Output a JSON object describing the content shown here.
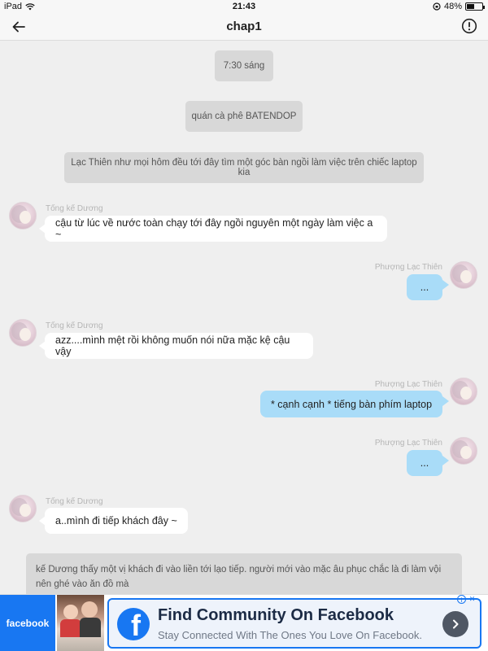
{
  "status_bar": {
    "device": "iPad",
    "time": "21:43",
    "battery": "48%",
    "battery_fraction": 0.48
  },
  "header": {
    "title": "chap1"
  },
  "messages": {
    "time_label": "7:30 sáng",
    "place_label": "quán cà phê BATENDOP",
    "narration_1": "Lạc Thiên như mọi hôm đều tới đây tìm một góc bàn ngồi làm việc trên chiếc laptop kia",
    "sender_a": "Tống kế Dương",
    "sender_b": "Phượng Lạc Thiên",
    "msg_1": "cậu từ lúc về nước toàn chạy tới đây ngồi nguyên một ngày làm việc a ~",
    "msg_2": "...",
    "msg_3": "azz....mình mệt rồi không muốn nói nữa mặc kệ cậu vậy",
    "msg_4": "* cạnh cạnh * tiếng bàn phím laptop",
    "msg_5": "...",
    "msg_6": "a..mình đi tiếp khách đây  ~",
    "narration_2": "kế Dương thấy một vị khách đi vào liền tới lạo tiếp. người mới vào mặc âu phục  chắc là đi làm vội nên ghé vào ăn đồ mà"
  },
  "ad": {
    "brand": "facebook",
    "headline": "Find Community On Facebook",
    "subline": "Stay Connected With The Ones You Love On Facebook.",
    "brand_color": "#1877f2"
  },
  "icons": {
    "back": "arrow-left-icon",
    "info": "info-icon",
    "wifi": "wifi-icon",
    "battery": "battery-icon",
    "ad_next": "chevron-right-icon"
  }
}
